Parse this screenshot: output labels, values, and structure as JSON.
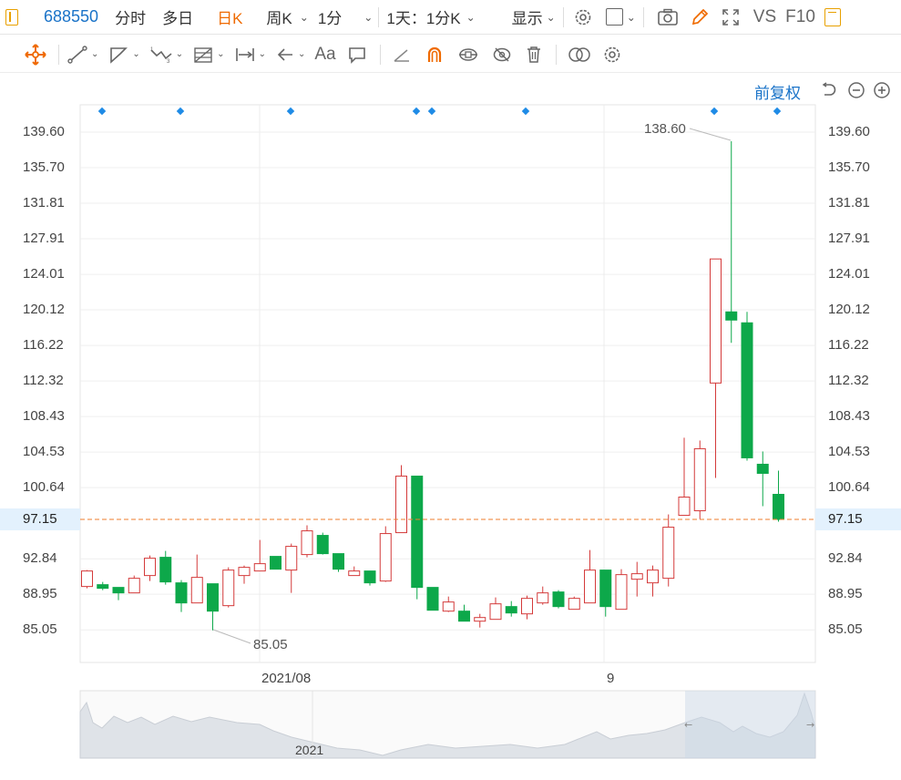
{
  "header": {
    "stock_code": "688550",
    "tabs": [
      "分时",
      "多日",
      "日K",
      "周K",
      "1分",
      "1天：1分K"
    ],
    "active_tab": "日K",
    "display_label": "显示",
    "vs_label": "VS",
    "f10_label": "F10"
  },
  "toolbar": {
    "text_tool_label": "Aa"
  },
  "chart": {
    "adjust_label": "前复权",
    "current_price": "97.15",
    "high_label": "138.60",
    "low_label": "85.05",
    "x_labels": [
      "2021/08",
      "9"
    ],
    "nav_year": "2021",
    "y_ticks": [
      "139.60",
      "135.70",
      "131.81",
      "127.91",
      "124.01",
      "120.12",
      "116.22",
      "112.32",
      "108.43",
      "104.53",
      "100.64",
      "97.15",
      "92.84",
      "88.95",
      "85.05"
    ]
  },
  "chart_data": {
    "type": "candlestick",
    "ylim": [
      81.0,
      143.0
    ],
    "last_price": 97.15,
    "high": 138.6,
    "low": 85.05,
    "candles": [
      {
        "o": 89.8,
        "c": 91.5,
        "h": 91.6,
        "l": 89.6
      },
      {
        "o": 90.0,
        "c": 89.6,
        "h": 90.3,
        "l": 89.4
      },
      {
        "o": 89.7,
        "c": 89.1,
        "h": 89.7,
        "l": 88.3
      },
      {
        "o": 89.1,
        "c": 90.7,
        "h": 91.0,
        "l": 89.1
      },
      {
        "o": 91.0,
        "c": 92.9,
        "h": 93.2,
        "l": 90.4
      },
      {
        "o": 93.0,
        "c": 90.3,
        "h": 93.7,
        "l": 90.0
      },
      {
        "o": 90.2,
        "c": 88.0,
        "h": 90.5,
        "l": 87.0
      },
      {
        "o": 88.0,
        "c": 90.8,
        "h": 93.3,
        "l": 88.0
      },
      {
        "o": 90.1,
        "c": 87.1,
        "h": 90.1,
        "l": 85.0
      },
      {
        "o": 87.7,
        "c": 91.6,
        "h": 91.9,
        "l": 87.5
      },
      {
        "o": 91.0,
        "c": 91.9,
        "h": 92.1,
        "l": 90.1
      },
      {
        "o": 91.5,
        "c": 92.3,
        "h": 94.9,
        "l": 91.5
      },
      {
        "o": 93.1,
        "c": 91.7,
        "h": 93.1,
        "l": 91.7
      },
      {
        "o": 91.6,
        "c": 94.2,
        "h": 94.5,
        "l": 89.1
      },
      {
        "o": 93.3,
        "c": 95.9,
        "h": 96.5,
        "l": 93.0
      },
      {
        "o": 95.4,
        "c": 93.4,
        "h": 95.7,
        "l": 93.3
      },
      {
        "o": 93.4,
        "c": 91.7,
        "h": 93.4,
        "l": 91.4
      },
      {
        "o": 91.0,
        "c": 91.5,
        "h": 92.0,
        "l": 91.0
      },
      {
        "o": 91.5,
        "c": 90.2,
        "h": 91.5,
        "l": 89.9
      },
      {
        "o": 90.4,
        "c": 95.6,
        "h": 96.4,
        "l": 90.3
      },
      {
        "o": 95.7,
        "c": 101.9,
        "h": 103.1,
        "l": 95.7
      },
      {
        "o": 101.9,
        "c": 89.7,
        "h": 101.9,
        "l": 88.4
      },
      {
        "o": 89.7,
        "c": 87.2,
        "h": 89.7,
        "l": 87.2
      },
      {
        "o": 87.1,
        "c": 88.1,
        "h": 88.7,
        "l": 87.0
      },
      {
        "o": 87.1,
        "c": 86.0,
        "h": 87.8,
        "l": 86.0
      },
      {
        "o": 86.0,
        "c": 86.4,
        "h": 86.8,
        "l": 85.3
      },
      {
        "o": 86.2,
        "c": 87.9,
        "h": 88.6,
        "l": 86.2
      },
      {
        "o": 87.6,
        "c": 86.9,
        "h": 88.2,
        "l": 86.5
      },
      {
        "o": 86.8,
        "c": 88.5,
        "h": 88.8,
        "l": 86.2
      },
      {
        "o": 88.0,
        "c": 89.1,
        "h": 89.8,
        "l": 87.8
      },
      {
        "o": 89.2,
        "c": 87.6,
        "h": 89.4,
        "l": 87.4
      },
      {
        "o": 87.3,
        "c": 88.5,
        "h": 88.7,
        "l": 87.3
      },
      {
        "o": 88.0,
        "c": 91.6,
        "h": 93.8,
        "l": 88.0
      },
      {
        "o": 91.6,
        "c": 87.6,
        "h": 91.6,
        "l": 86.5
      },
      {
        "o": 87.3,
        "c": 91.1,
        "h": 91.7,
        "l": 87.3
      },
      {
        "o": 90.6,
        "c": 91.2,
        "h": 92.5,
        "l": 88.7
      },
      {
        "o": 90.2,
        "c": 91.6,
        "h": 92.1,
        "l": 88.7
      },
      {
        "o": 90.7,
        "c": 96.3,
        "h": 97.7,
        "l": 89.8
      },
      {
        "o": 97.6,
        "c": 99.6,
        "h": 106.1,
        "l": 97.6
      },
      {
        "o": 98.1,
        "c": 104.9,
        "h": 105.8,
        "l": 97.2
      },
      {
        "o": 112.1,
        "c": 125.7,
        "h": 125.7,
        "l": 101.7
      },
      {
        "o": 119.9,
        "c": 119.0,
        "h": 138.6,
        "l": 116.5
      },
      {
        "o": 118.7,
        "c": 103.9,
        "h": 119.9,
        "l": 103.6
      },
      {
        "o": 103.2,
        "c": 102.2,
        "h": 104.6,
        "l": 98.6
      },
      {
        "o": 99.9,
        "c": 97.15,
        "h": 102.5,
        "l": 96.9
      }
    ]
  }
}
